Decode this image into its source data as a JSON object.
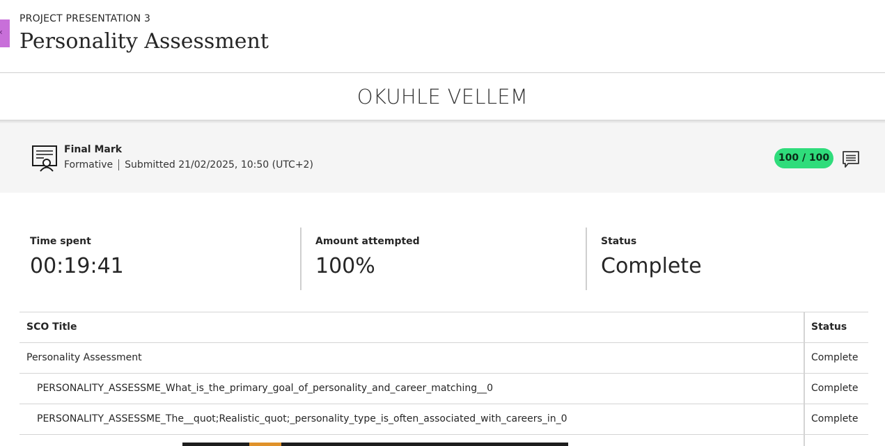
{
  "header": {
    "course": "PROJECT PRESENTATION 3",
    "title": "Personality Assessment",
    "back_icon": "chevron-left-icon"
  },
  "student": {
    "name": "OKUHLE VELLEM"
  },
  "mark": {
    "icon": "certificate-icon",
    "title": "Final Mark",
    "type": "Formative",
    "submitted": "Submitted 21/02/2025, 10:50 (UTC+2)",
    "score": "100 / 100",
    "score_color": "#2fdc7b",
    "feedback_icon": "comment-icon"
  },
  "stats": {
    "time_label": "Time spent",
    "time_value": "00:19:41",
    "amount_label": "Amount attempted",
    "amount_value": "100%",
    "status_label": "Status",
    "status_value": "Complete"
  },
  "table": {
    "headers": [
      "SCO Title",
      "Status"
    ],
    "rows": [
      {
        "title": "Personality Assessment",
        "status": "Complete"
      },
      {
        "title": "PERSONALITY_ASSESSME_What_is_the_primary_goal_of_personality_and_career_matching__0",
        "status": "Complete"
      },
      {
        "title": "PERSONALITY_ASSESSME_The__quot;Realistic_quot;_personality_type_is_often_associated_with_careers_in_0",
        "status": "Complete"
      }
    ]
  }
}
